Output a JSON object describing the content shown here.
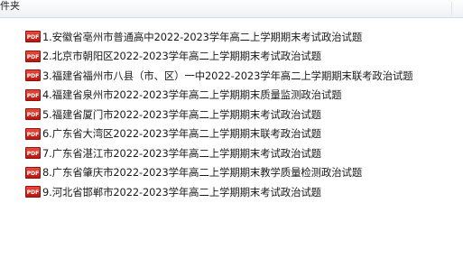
{
  "header": {
    "title": "件夹"
  },
  "files": [
    {
      "icon": "pdf-file-icon",
      "icon_text": "PDF",
      "name": "1.安徽省亳州市普通高中2022-2023学年高二上学期期末考试政治试题"
    },
    {
      "icon": "pdf-file-icon",
      "icon_text": "PDF",
      "name": "2.北京市朝阳区2022-2023学年高二上学期期末考试政治试题"
    },
    {
      "icon": "pdf-file-icon",
      "icon_text": "PDF",
      "name": "3.福建省福州市八县（市、区）一中2022-2023学年高二上学期期末联考政治试题"
    },
    {
      "icon": "pdf-file-icon",
      "icon_text": "PDF",
      "name": "4.福建省泉州市2022-2023学年高二上学期期末质量监测政治试题"
    },
    {
      "icon": "pdf-file-icon",
      "icon_text": "PDF",
      "name": "5.福建省厦门市2022-2023学年高二上学期期末考试政治试题"
    },
    {
      "icon": "pdf-file-icon",
      "icon_text": "PDF",
      "name": "6.广东省大湾区2022-2023学年高二上学期期末联考政治试题"
    },
    {
      "icon": "pdf-file-icon",
      "icon_text": "PDF",
      "name": "7.广东省湛江市2022-2023学年高二上学期期末考试政治试题"
    },
    {
      "icon": "pdf-file-icon",
      "icon_text": "PDF",
      "name": "8.广东省肇庆市2022-2023学年高二上学期期末教学质量检测政治试题"
    },
    {
      "icon": "pdf-file-icon",
      "icon_text": "PDF",
      "name": "9.河北省邯郸市2022-2023学年高二上学期期末考试政治试题"
    }
  ],
  "colors": {
    "header_bg": "#eef1f5",
    "pdf_icon": "#d42a1f",
    "text": "#1a1a1a"
  }
}
